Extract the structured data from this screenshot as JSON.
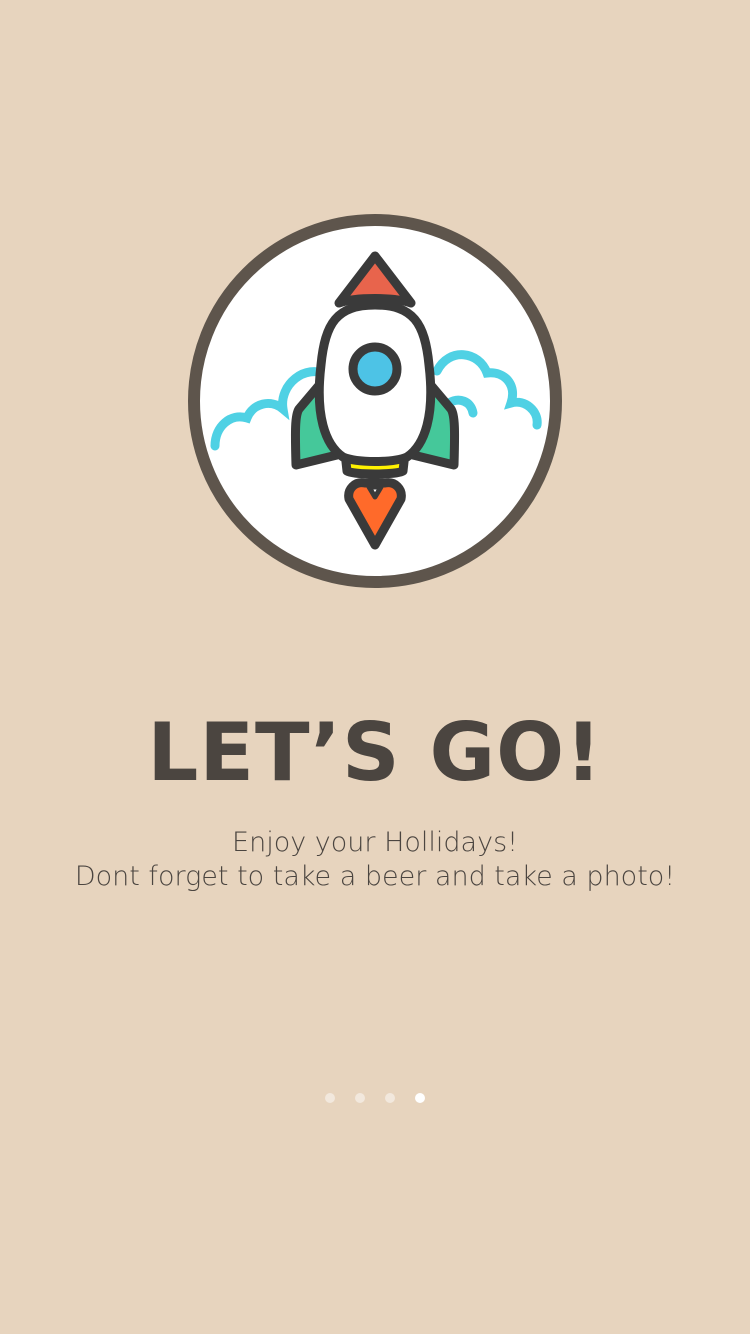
{
  "colors": {
    "background": "#E7D4BE",
    "title": "#4B4540",
    "subtitle": "#4B4540",
    "dot_inactive": "#F2E8DD",
    "dot_active": "#FFFFFF",
    "badge_ring": "#5E554C",
    "badge_fill": "#FFFFFF",
    "clouds": "#4FD1E4",
    "rocket_outline": "#3A3A3A",
    "rocket_nose": "#E8644C",
    "rocket_fins": "#45C89A",
    "rocket_window": "#4DC3E6",
    "rocket_band": "#FFF200",
    "rocket_flame": "#FF6A2A"
  },
  "hero": {
    "icon": "rocket-icon",
    "cloud_icon": "cloud-icon"
  },
  "content": {
    "title": "LET’S GO!",
    "subtitle_line1": "Enjoy your Hollidays!",
    "subtitle_line2": "Dont forget to take a beer and take a photo!"
  },
  "pager": {
    "total": 4,
    "active_index": 3,
    "dots": [
      {
        "active": false
      },
      {
        "active": false
      },
      {
        "active": false
      },
      {
        "active": true
      }
    ]
  }
}
